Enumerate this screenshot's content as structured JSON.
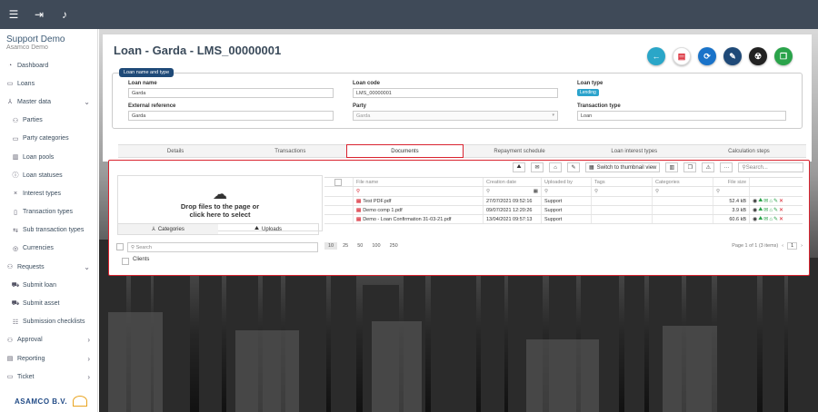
{
  "topbar": {
    "icons": [
      "menu-icon",
      "logout-icon",
      "bell-icon"
    ]
  },
  "brand": {
    "title": "Support Demo",
    "subtitle": "Asamco Demo"
  },
  "sidebar": {
    "items": [
      {
        "label": "Dashboard",
        "icon": "dashboard-icon",
        "sub": false,
        "chev": ""
      },
      {
        "label": "Loans",
        "icon": "loans-icon",
        "sub": false,
        "chev": ""
      },
      {
        "label": "Master data",
        "icon": "master-data-icon",
        "sub": false,
        "chev": "⌄"
      },
      {
        "label": "Parties",
        "icon": "parties-icon",
        "sub": true,
        "chev": ""
      },
      {
        "label": "Party categories",
        "icon": "party-categories-icon",
        "sub": true,
        "chev": ""
      },
      {
        "label": "Loan pools",
        "icon": "loan-pools-icon",
        "sub": true,
        "chev": ""
      },
      {
        "label": "Loan statuses",
        "icon": "loan-statuses-icon",
        "sub": true,
        "chev": ""
      },
      {
        "label": "Interest types",
        "icon": "interest-types-icon",
        "sub": true,
        "chev": ""
      },
      {
        "label": "Transaction types",
        "icon": "transaction-types-icon",
        "sub": true,
        "chev": ""
      },
      {
        "label": "Sub transaction types",
        "icon": "sub-transaction-types-icon",
        "sub": true,
        "chev": ""
      },
      {
        "label": "Currencies",
        "icon": "currencies-icon",
        "sub": true,
        "chev": ""
      },
      {
        "label": "Requests",
        "icon": "requests-icon",
        "sub": false,
        "chev": "⌄"
      },
      {
        "label": "Submit loan",
        "icon": "submit-loan-icon",
        "sub": true,
        "chev": ""
      },
      {
        "label": "Submit asset",
        "icon": "submit-asset-icon",
        "sub": true,
        "chev": ""
      },
      {
        "label": "Submission checklists",
        "icon": "submission-checklists-icon",
        "sub": true,
        "chev": ""
      },
      {
        "label": "Approval",
        "icon": "approval-icon",
        "sub": false,
        "chev": "›"
      },
      {
        "label": "Reporting",
        "icon": "reporting-icon",
        "sub": false,
        "chev": "›"
      },
      {
        "label": "Ticket",
        "icon": "ticket-icon",
        "sub": false,
        "chev": "›"
      }
    ],
    "logo_text": "ASAMCO B.V."
  },
  "fabs": [
    {
      "name": "back-button",
      "icon": "back-arrow-icon",
      "color": "#2aa6c8",
      "glyph": "←"
    },
    {
      "name": "pdf-button",
      "icon": "pdf-icon",
      "color": "#ffffff",
      "glyph": "▤"
    },
    {
      "name": "refresh-button",
      "icon": "refresh-icon",
      "color": "#1a73c9",
      "glyph": "⟳"
    },
    {
      "name": "edit-button",
      "icon": "edit-icon",
      "color": "#1f4a78",
      "glyph": "✎"
    },
    {
      "name": "hazard-button",
      "icon": "radiation-icon",
      "color": "#222222",
      "glyph": "☢"
    },
    {
      "name": "copy-button",
      "icon": "copy-icon",
      "color": "#2aa34a",
      "glyph": "❐"
    }
  ],
  "page": {
    "title": "Loan - Garda - LMS_00000001"
  },
  "section_legend": "Loan name and type",
  "fields": {
    "loan_name": {
      "label": "Loan name",
      "value": "Garda"
    },
    "loan_code": {
      "label": "Loan code",
      "value": "LMS_00000001"
    },
    "loan_type": {
      "label": "Loan type",
      "value": "Lending"
    },
    "external_reference": {
      "label": "External reference",
      "value": "Garda"
    },
    "party": {
      "label": "Party",
      "value": "Garda"
    },
    "transaction_type": {
      "label": "Transaction type",
      "value": "Loan"
    }
  },
  "tabs": [
    "Details",
    "Transactions",
    "Documents",
    "Repayment schedule",
    "Loan interest types",
    "Calculation steps"
  ],
  "active_tab": "Documents",
  "documents": {
    "drop_text_1": "Drop files to the page or",
    "drop_text_2": "click here to select",
    "left_tabs": {
      "categories": "Categories",
      "uploads": "Uploads"
    },
    "search_placeholder": "Search",
    "tree_item": "Clients",
    "toolbar": {
      "thumbnail": "Switch to thumbnail view",
      "search_placeholder": "Search...",
      "more": "···"
    },
    "columns": [
      "File name",
      "Creation date",
      "Uploaded by",
      "Tags",
      "Categories",
      "File size"
    ],
    "rows": [
      {
        "name": "Test PDF.pdf",
        "date": "27/07/2021 09:52:16",
        "by": "Support",
        "size": "52.4 kB"
      },
      {
        "name": "Demo comp 1.pdf",
        "date": "09/07/2021 12:20:26",
        "by": "Support",
        "size": "3.9 kB"
      },
      {
        "name": "Demo - Loan Confirmation 31-03-21.pdf",
        "date": "13/04/2021 09:57:13",
        "by": "Support",
        "size": "60.6 kB"
      }
    ],
    "page_sizes": [
      "10",
      "25",
      "50",
      "100",
      "250"
    ],
    "page_info": "Page 1 of 1 (3 items)",
    "current_page": "1"
  },
  "colors": {
    "topbar": "#3f4a58",
    "accent_red": "#d9232f",
    "legend": "#1f4a78"
  }
}
